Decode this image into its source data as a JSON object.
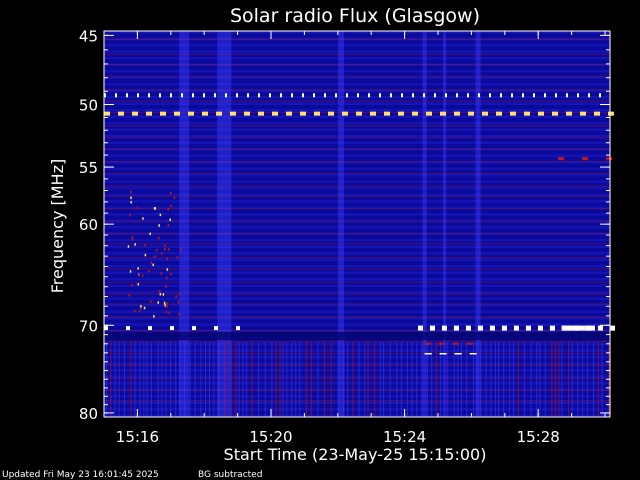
{
  "chart_data": {
    "type": "heatmap",
    "title": "Solar radio Flux (Glasgow)",
    "xlabel": "Start Time (23-May-25 15:15:00)",
    "ylabel": "Frequency [MHz]",
    "x_range_minutes": [
      15.0,
      30.15
    ],
    "x_ticks": [
      {
        "minute": 16,
        "label": "15:16"
      },
      {
        "minute": 20,
        "label": "15:20"
      },
      {
        "minute": 24,
        "label": "15:24"
      },
      {
        "minute": 28,
        "label": "15:28"
      }
    ],
    "y_scale": "log",
    "ylim_mhz": [
      44.7,
      80.5
    ],
    "y_ticks": [
      {
        "mhz": 45,
        "label": "45"
      },
      {
        "mhz": 50,
        "label": "50"
      },
      {
        "mhz": 55,
        "label": "55"
      },
      {
        "mhz": 60,
        "label": "60"
      },
      {
        "mhz": 70,
        "label": "70"
      },
      {
        "mhz": 80,
        "label": "80"
      }
    ],
    "colors": {
      "background": "#0a0a9a",
      "low": "#1e1ecc",
      "mid": "#3c3cff",
      "high": "#c01818",
      "peak": "#ffe070",
      "saturated": "#ffffff"
    },
    "interference_bands_mhz": [
      49.3,
      50.7,
      54.3,
      70.3,
      72.0,
      73.1
    ],
    "gap_band_mhz": [
      70.7,
      71.6
    ]
  },
  "footer": {
    "updated": "Updated Fri May 23 16:01:45 2025",
    "note": "BG subtracted"
  }
}
